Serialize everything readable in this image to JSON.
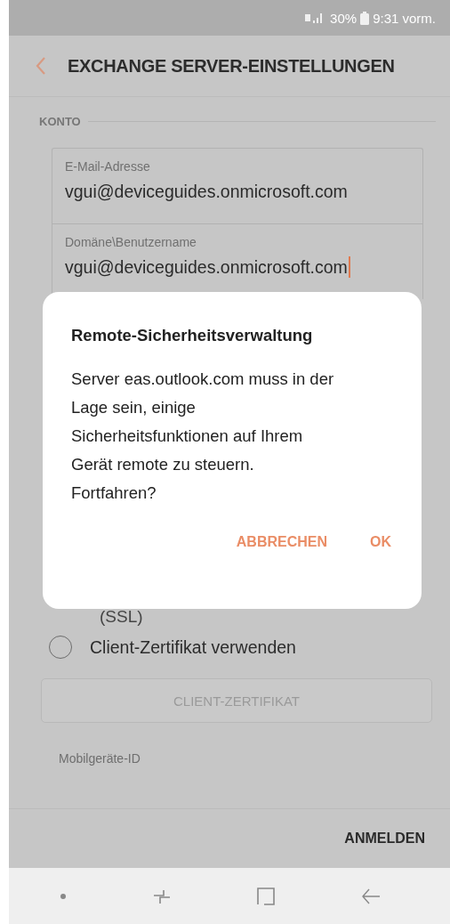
{
  "status_bar": {
    "battery": "30%",
    "time": "9:31 vorm."
  },
  "header": {
    "title": "EXCHANGE SERVER-EINSTELLUNGEN"
  },
  "account": {
    "heading": "KONTO",
    "fields": [
      {
        "label": "E-Mail-Adresse",
        "value": "vgui@deviceguides.onmicrosoft.com",
        "focused": false
      },
      {
        "label": "Domäne\\Benutzername",
        "value": "vgui@deviceguides.onmicrosoft.com",
        "focused": true
      }
    ]
  },
  "security": {
    "ssl_label": "(SSL)",
    "client_cert": {
      "label": "Client-Zertifikat verwenden",
      "checked": false
    },
    "cert_button": {
      "label": "CLIENT-ZERTIFIKAT",
      "disabled": true
    }
  },
  "device": {
    "label": "Mobilgeräte-ID"
  },
  "footer": {
    "sign_in": "ANMELDEN"
  },
  "dialog": {
    "title": "Remote-Sicherheitsverwaltung",
    "message": "Server eas.outlook.com muss in der Lage sein, einige Sicherheitsfunktionen auf Ihrem Gerät remote zu steuern. Fortfahren?",
    "buttons": [
      {
        "label": "ABBRECHEN"
      },
      {
        "label": "OK"
      }
    ]
  }
}
